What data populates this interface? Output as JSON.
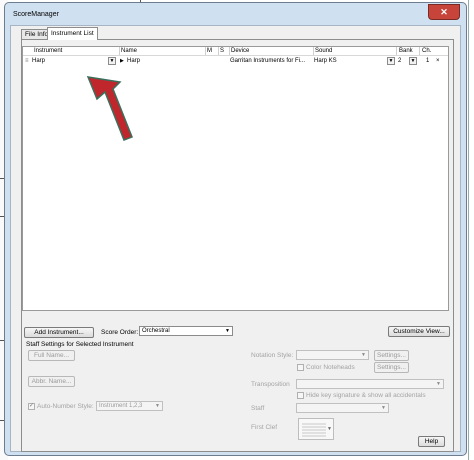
{
  "window": {
    "title": "ScoreManager",
    "close_glyph": "✕"
  },
  "tabs": [
    {
      "label": "File Info"
    },
    {
      "label": "Instrument List"
    }
  ],
  "grid": {
    "headers": {
      "instrument": "Instrument",
      "name": "Name",
      "m": "M",
      "s": "S",
      "device": "Device",
      "sound": "Sound",
      "bank": "Bank",
      "ch": "Ch."
    },
    "row": {
      "drag_handle": "≡",
      "instrument": "Harp",
      "play_glyph": "▶",
      "name": "Harp",
      "device": "Garritan Instruments for Fi...",
      "sound": "Harp KS",
      "bank": "2",
      "ch": "1",
      "delete_glyph": "×"
    }
  },
  "toolbar": {
    "add_instrument": "Add Instrument...",
    "score_order_label": "Score Order:",
    "score_order_value": "Orchestral",
    "customize_view": "Customize View..."
  },
  "staff_settings": {
    "group_label": "Staff Settings for Selected Instrument",
    "full_name": "Full Name...",
    "abbr_name": "Abbr. Name...",
    "auto_number_label": "Auto-Number Style:",
    "auto_number_checked_glyph": "✓",
    "auto_number_value": "Instrument 1,2,3",
    "notation_style_label": "Notation Style:",
    "notation_settings": "Settings...",
    "color_noteheads": "Color Noteheads",
    "color_settings": "Settings...",
    "transposition_label": "Transposition",
    "hide_key_signature": "Hide key signature & show all accidentals",
    "staff_label": "Staff",
    "first_clef_label": "First Clef",
    "help": "Help"
  },
  "colors": {
    "frame": "#cfe0f1",
    "close": "#c7443a",
    "arrow_fill": "#c0272d",
    "arrow_outline": "#3a6f5c"
  }
}
